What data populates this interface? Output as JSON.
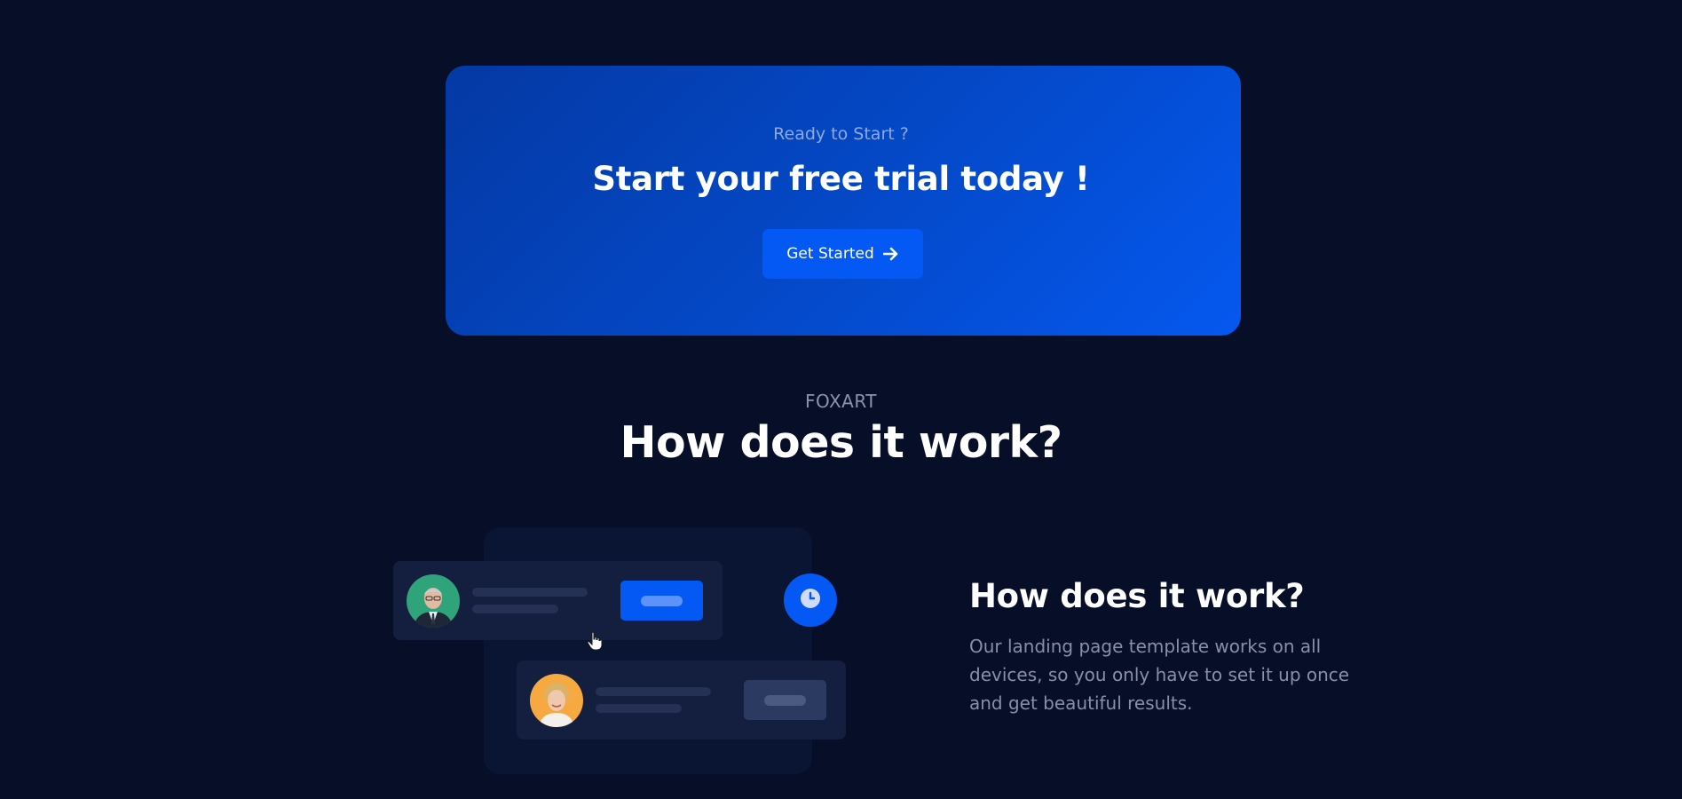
{
  "colors": {
    "page_background": "#060f27",
    "cta_gradient_start": "#0439a4",
    "cta_gradient_end": "#0558ef",
    "accent_blue": "#0459f5",
    "card_background": "#141f3f",
    "muted_text": "#8790a9"
  },
  "cta": {
    "eyebrow": "Ready to Start ?",
    "title": "Start your free trial today !",
    "button_label": "Get Started",
    "button_icon": "arrow-right-icon"
  },
  "section": {
    "eyebrow": "FOXART",
    "title": "How does it work?"
  },
  "illustration": {
    "cards": [
      {
        "avatar": "man-avatar",
        "button_style": "primary"
      },
      {
        "avatar": "woman-avatar",
        "button_style": "muted"
      }
    ],
    "badge_icon": "clock-icon",
    "pointer_icon": "hand-pointer-icon"
  },
  "feature": {
    "title": "How does it work?",
    "description": "Our landing page template works on all devices, so you only have to set it up once and get beautiful results."
  }
}
